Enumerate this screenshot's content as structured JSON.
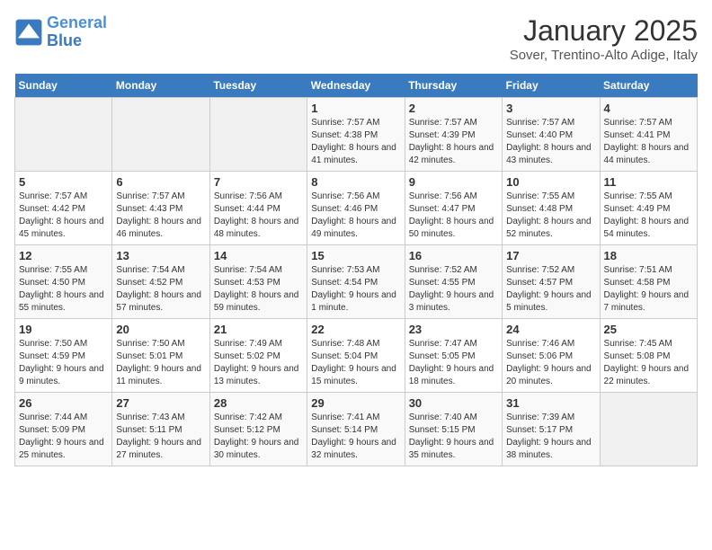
{
  "header": {
    "logo_line1": "General",
    "logo_line2": "Blue",
    "month": "January 2025",
    "location": "Sover, Trentino-Alto Adige, Italy"
  },
  "weekdays": [
    "Sunday",
    "Monday",
    "Tuesday",
    "Wednesday",
    "Thursday",
    "Friday",
    "Saturday"
  ],
  "weeks": [
    [
      {
        "day": "",
        "info": ""
      },
      {
        "day": "",
        "info": ""
      },
      {
        "day": "",
        "info": ""
      },
      {
        "day": "1",
        "info": "Sunrise: 7:57 AM\nSunset: 4:38 PM\nDaylight: 8 hours and 41 minutes."
      },
      {
        "day": "2",
        "info": "Sunrise: 7:57 AM\nSunset: 4:39 PM\nDaylight: 8 hours and 42 minutes."
      },
      {
        "day": "3",
        "info": "Sunrise: 7:57 AM\nSunset: 4:40 PM\nDaylight: 8 hours and 43 minutes."
      },
      {
        "day": "4",
        "info": "Sunrise: 7:57 AM\nSunset: 4:41 PM\nDaylight: 8 hours and 44 minutes."
      }
    ],
    [
      {
        "day": "5",
        "info": "Sunrise: 7:57 AM\nSunset: 4:42 PM\nDaylight: 8 hours and 45 minutes."
      },
      {
        "day": "6",
        "info": "Sunrise: 7:57 AM\nSunset: 4:43 PM\nDaylight: 8 hours and 46 minutes."
      },
      {
        "day": "7",
        "info": "Sunrise: 7:56 AM\nSunset: 4:44 PM\nDaylight: 8 hours and 48 minutes."
      },
      {
        "day": "8",
        "info": "Sunrise: 7:56 AM\nSunset: 4:46 PM\nDaylight: 8 hours and 49 minutes."
      },
      {
        "day": "9",
        "info": "Sunrise: 7:56 AM\nSunset: 4:47 PM\nDaylight: 8 hours and 50 minutes."
      },
      {
        "day": "10",
        "info": "Sunrise: 7:55 AM\nSunset: 4:48 PM\nDaylight: 8 hours and 52 minutes."
      },
      {
        "day": "11",
        "info": "Sunrise: 7:55 AM\nSunset: 4:49 PM\nDaylight: 8 hours and 54 minutes."
      }
    ],
    [
      {
        "day": "12",
        "info": "Sunrise: 7:55 AM\nSunset: 4:50 PM\nDaylight: 8 hours and 55 minutes."
      },
      {
        "day": "13",
        "info": "Sunrise: 7:54 AM\nSunset: 4:52 PM\nDaylight: 8 hours and 57 minutes."
      },
      {
        "day": "14",
        "info": "Sunrise: 7:54 AM\nSunset: 4:53 PM\nDaylight: 8 hours and 59 minutes."
      },
      {
        "day": "15",
        "info": "Sunrise: 7:53 AM\nSunset: 4:54 PM\nDaylight: 9 hours and 1 minute."
      },
      {
        "day": "16",
        "info": "Sunrise: 7:52 AM\nSunset: 4:55 PM\nDaylight: 9 hours and 3 minutes."
      },
      {
        "day": "17",
        "info": "Sunrise: 7:52 AM\nSunset: 4:57 PM\nDaylight: 9 hours and 5 minutes."
      },
      {
        "day": "18",
        "info": "Sunrise: 7:51 AM\nSunset: 4:58 PM\nDaylight: 9 hours and 7 minutes."
      }
    ],
    [
      {
        "day": "19",
        "info": "Sunrise: 7:50 AM\nSunset: 4:59 PM\nDaylight: 9 hours and 9 minutes."
      },
      {
        "day": "20",
        "info": "Sunrise: 7:50 AM\nSunset: 5:01 PM\nDaylight: 9 hours and 11 minutes."
      },
      {
        "day": "21",
        "info": "Sunrise: 7:49 AM\nSunset: 5:02 PM\nDaylight: 9 hours and 13 minutes."
      },
      {
        "day": "22",
        "info": "Sunrise: 7:48 AM\nSunset: 5:04 PM\nDaylight: 9 hours and 15 minutes."
      },
      {
        "day": "23",
        "info": "Sunrise: 7:47 AM\nSunset: 5:05 PM\nDaylight: 9 hours and 18 minutes."
      },
      {
        "day": "24",
        "info": "Sunrise: 7:46 AM\nSunset: 5:06 PM\nDaylight: 9 hours and 20 minutes."
      },
      {
        "day": "25",
        "info": "Sunrise: 7:45 AM\nSunset: 5:08 PM\nDaylight: 9 hours and 22 minutes."
      }
    ],
    [
      {
        "day": "26",
        "info": "Sunrise: 7:44 AM\nSunset: 5:09 PM\nDaylight: 9 hours and 25 minutes."
      },
      {
        "day": "27",
        "info": "Sunrise: 7:43 AM\nSunset: 5:11 PM\nDaylight: 9 hours and 27 minutes."
      },
      {
        "day": "28",
        "info": "Sunrise: 7:42 AM\nSunset: 5:12 PM\nDaylight: 9 hours and 30 minutes."
      },
      {
        "day": "29",
        "info": "Sunrise: 7:41 AM\nSunset: 5:14 PM\nDaylight: 9 hours and 32 minutes."
      },
      {
        "day": "30",
        "info": "Sunrise: 7:40 AM\nSunset: 5:15 PM\nDaylight: 9 hours and 35 minutes."
      },
      {
        "day": "31",
        "info": "Sunrise: 7:39 AM\nSunset: 5:17 PM\nDaylight: 9 hours and 38 minutes."
      },
      {
        "day": "",
        "info": ""
      }
    ]
  ]
}
